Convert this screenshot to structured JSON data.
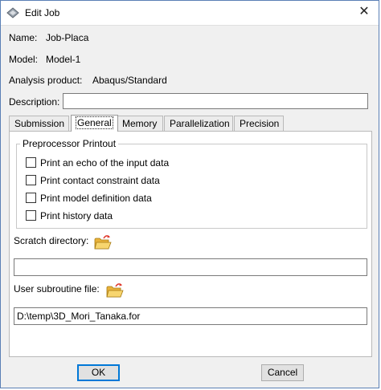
{
  "window": {
    "title": "Edit Job",
    "close_glyph": "✕"
  },
  "fields": {
    "name_label": "Name:",
    "name_value": "Job-Placa",
    "model_label": "Model:",
    "model_value": "Model-1",
    "analysis_label": "Analysis product:",
    "analysis_value": "Abaqus/Standard",
    "description_label": "Description:",
    "description_value": ""
  },
  "tabs": [
    {
      "label": "Submission",
      "active": false
    },
    {
      "label": "General",
      "active": true
    },
    {
      "label": "Memory",
      "active": false
    },
    {
      "label": "Parallelization",
      "active": false
    },
    {
      "label": "Precision",
      "active": false
    }
  ],
  "preprocessor": {
    "title": "Preprocessor Printout",
    "options": [
      {
        "label": "Print an echo of the input data",
        "checked": false
      },
      {
        "label": "Print contact constraint data",
        "checked": false
      },
      {
        "label": "Print model definition data",
        "checked": false
      },
      {
        "label": "Print history data",
        "checked": false
      }
    ]
  },
  "scratch": {
    "label": "Scratch directory:",
    "value": "",
    "icon": "folder-open-icon"
  },
  "subroutine": {
    "label": "User subroutine file:",
    "value": "D:\\temp\\3D_Mori_Tanaka.for",
    "icon": "folder-open-icon"
  },
  "buttons": {
    "ok": "OK",
    "cancel": "Cancel"
  },
  "colors": {
    "window_border": "#5a7fb5",
    "folder": "#f2c14e",
    "arrow": "#e03a2f",
    "default_button_border": "#0078d7"
  }
}
